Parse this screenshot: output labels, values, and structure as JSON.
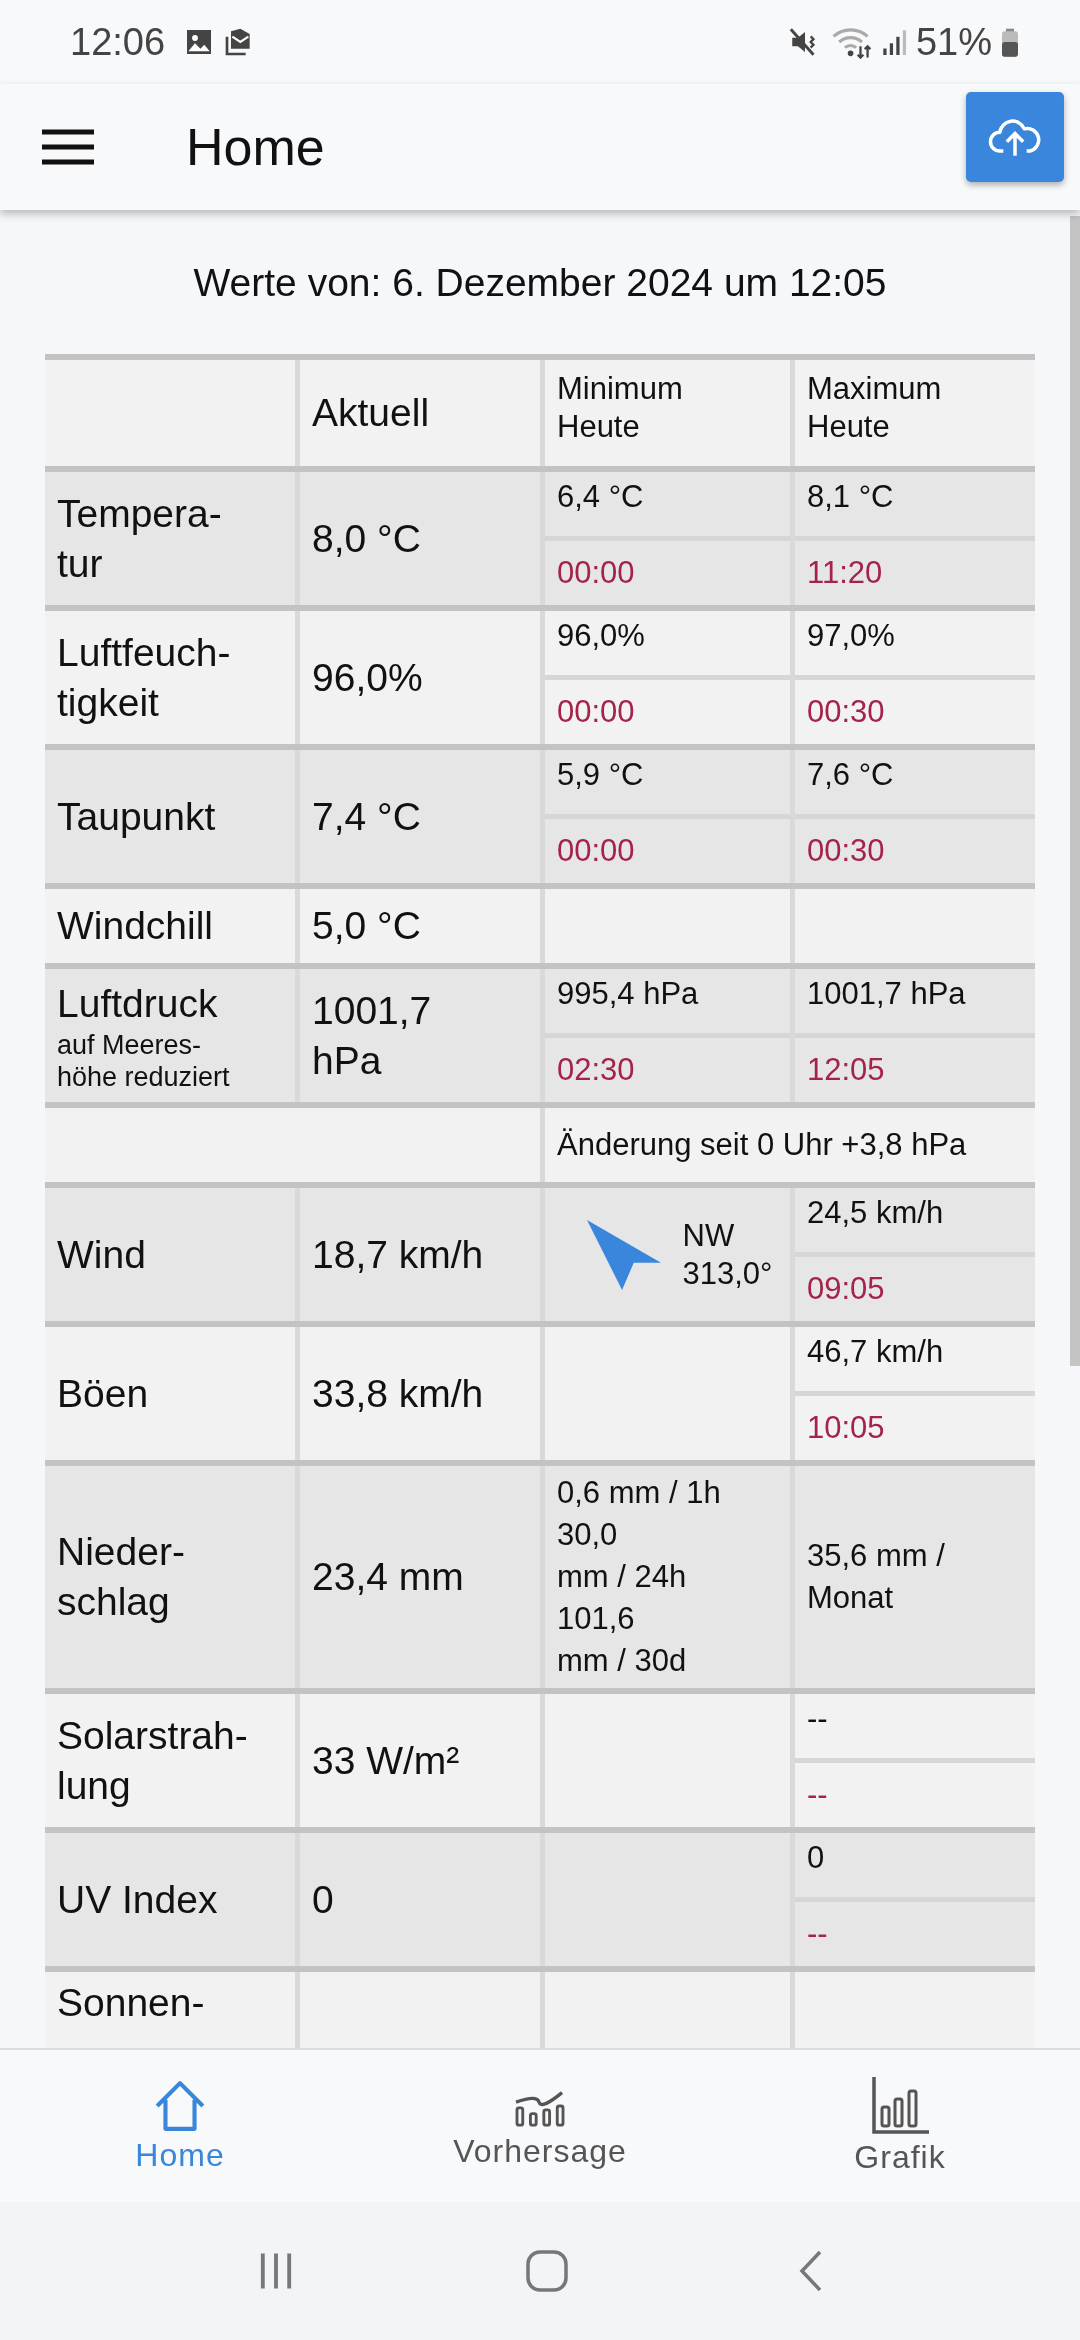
{
  "status_bar": {
    "time": "12:06",
    "battery": "51%"
  },
  "app_bar": {
    "title": "Home"
  },
  "heading": "Werte von: 6. Dezember 2024 um 12:05",
  "table": {
    "columns": [
      "Aktuell",
      "Minimum\nHeute",
      "Maximum\nHeute"
    ],
    "rows": [
      {
        "kind": "data",
        "label": "Tempera-\ntur",
        "current": "8,0 °C",
        "min": {
          "kind": "split",
          "value": "6,4 °C",
          "time": "00:00"
        },
        "max": {
          "kind": "split",
          "value": "8,1 °C",
          "time": "11:20"
        }
      },
      {
        "kind": "data",
        "label": "Luftfeuch-\ntigkeit",
        "current": "96,0%",
        "min": {
          "kind": "split",
          "value": "96,0%",
          "time": "00:00"
        },
        "max": {
          "kind": "split",
          "value": "97,0%",
          "time": "00:30"
        }
      },
      {
        "kind": "data",
        "label": "Taupunkt",
        "current": "7,4 °C",
        "min": {
          "kind": "split",
          "value": "5,9 °C",
          "time": "00:00"
        },
        "max": {
          "kind": "split",
          "value": "7,6 °C",
          "time": "00:30"
        }
      },
      {
        "kind": "data",
        "label": "Windchill",
        "current": "5,0 °C",
        "min": {
          "kind": "empty"
        },
        "max": {
          "kind": "empty"
        }
      },
      {
        "kind": "data",
        "label": "Luftdruck",
        "sublabel": "auf Meeres-\nhöhe reduziert",
        "current": "1001,7\nhPa",
        "min": {
          "kind": "split",
          "value": "995,4 hPa",
          "time": "02:30"
        },
        "max": {
          "kind": "split",
          "value": "1001,7 hPa",
          "time": "12:05"
        }
      },
      {
        "kind": "note",
        "text": "Änderung seit 0 Uhr +3,8 hPa"
      },
      {
        "kind": "data",
        "label": "Wind",
        "current": "18,7 km/h",
        "min": {
          "kind": "wind",
          "direction": "NW",
          "degrees": "313,0°"
        },
        "max": {
          "kind": "split",
          "value": "24,5 km/h",
          "time": "09:05"
        }
      },
      {
        "kind": "data",
        "label": "Böen",
        "current": "33,8 km/h",
        "min": {
          "kind": "empty"
        },
        "max": {
          "kind": "split",
          "value": "46,7 km/h",
          "time": "10:05"
        }
      },
      {
        "kind": "data",
        "label": "Nieder-\nschlag",
        "current": "23,4 mm",
        "min": {
          "kind": "lines",
          "lines": [
            "0,6 mm / 1h",
            "30,0\nmm / 24h",
            "101,6\nmm / 30d"
          ]
        },
        "max": {
          "kind": "lines",
          "lines": [
            "35,6 mm /\nMonat"
          ]
        }
      },
      {
        "kind": "data",
        "label": "Solarstrah-\nlung",
        "current": "33 W/m²",
        "min": {
          "kind": "empty"
        },
        "max": {
          "kind": "split",
          "value": "--",
          "time": "--"
        }
      },
      {
        "kind": "data",
        "label": "UV Index",
        "current": "0",
        "min": {
          "kind": "empty"
        },
        "max": {
          "kind": "split",
          "value": "0",
          "time": "--"
        }
      },
      {
        "kind": "data",
        "label": "Sonnen-",
        "min": {
          "kind": "empty"
        },
        "max": {
          "kind": "empty"
        }
      }
    ]
  },
  "bottom_nav": [
    {
      "label": "Home",
      "selected": true
    },
    {
      "label": "Vorhersage",
      "selected": false
    },
    {
      "label": "Grafik",
      "selected": false
    }
  ]
}
